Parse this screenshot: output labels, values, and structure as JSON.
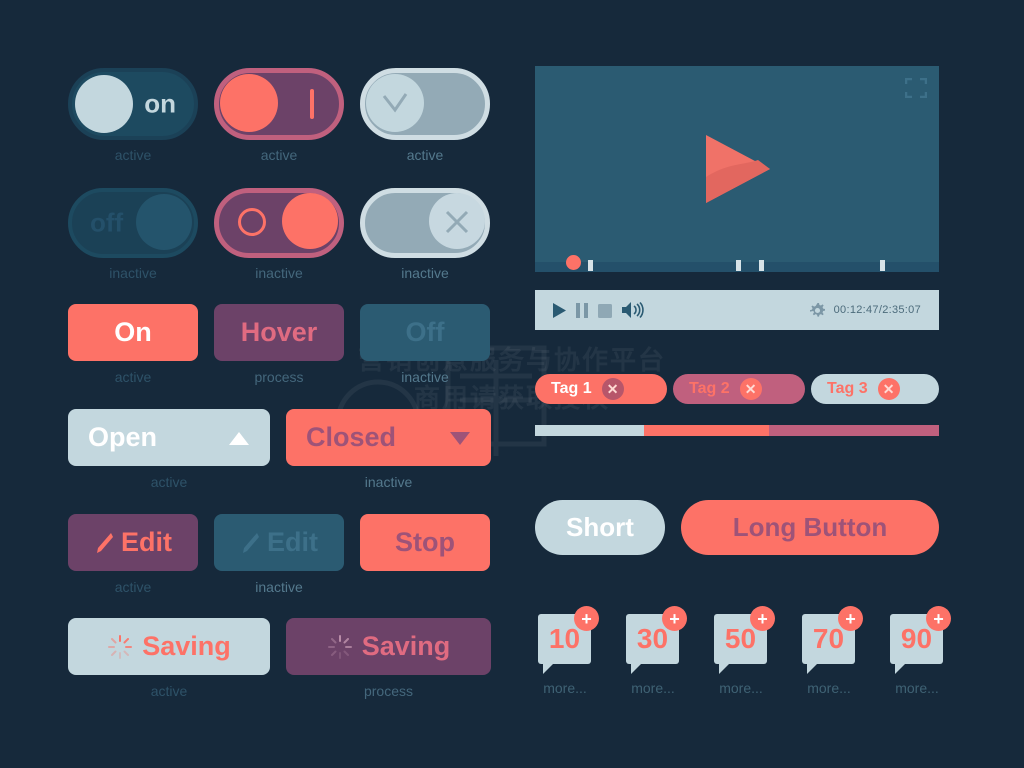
{
  "background_color": "#16293b",
  "palette": {
    "coral": "#fd7267",
    "purple": "#6c4268",
    "pink_border": "#c0607e",
    "light_grey": "#c3d7de",
    "teal": "#2b5b72",
    "dark_teal": "#1d4a60",
    "caption": "#2e5268",
    "white": "#ffffff"
  },
  "watermark": {
    "line1": "营销创意服务与协作平台",
    "line2": "商用请获取授权"
  },
  "toggles": [
    {
      "id": "toggle-on-dark",
      "label": "on",
      "caption": "active",
      "style": "dark-teal",
      "knob_side": "left",
      "knob_color": "#c3d7de",
      "label_color": "#c3d7de",
      "icon": "none"
    },
    {
      "id": "toggle-on-purple",
      "label": "|",
      "caption": "active",
      "style": "purple",
      "knob_side": "left",
      "knob_color": "#fd7267",
      "label_color": "#fd7267",
      "icon": "bar"
    },
    {
      "id": "toggle-on-grey",
      "label": "",
      "caption": "active",
      "style": "grey",
      "knob_side": "left",
      "knob_color": "#c3d7de",
      "label_color": "#93aab6",
      "icon": "check"
    },
    {
      "id": "toggle-off-dark",
      "label": "off",
      "caption": "inactive",
      "style": "dark-teal",
      "knob_side": "right",
      "knob_color": "#2b5b72",
      "label_color": "#24506a",
      "icon": "none"
    },
    {
      "id": "toggle-off-purple",
      "label": "O",
      "caption": "inactive",
      "style": "purple",
      "knob_side": "right",
      "knob_color": "#fd7267",
      "label_color": "#fd7267",
      "icon": "circle"
    },
    {
      "id": "toggle-off-grey",
      "label": "",
      "caption": "inactive",
      "style": "grey",
      "knob_side": "right",
      "knob_color": "#c7d8e0",
      "label_color": "#93aab6",
      "icon": "cross"
    }
  ],
  "state_buttons": [
    {
      "id": "btn-on",
      "label": "On",
      "caption": "active",
      "bg": "#fd7267",
      "fg": "#ffffff"
    },
    {
      "id": "btn-hover",
      "label": "Hover",
      "caption": "process",
      "bg": "#6c4268",
      "fg": "#e06b81"
    },
    {
      "id": "btn-off",
      "label": "Off",
      "caption": "inactive",
      "bg": "#2b5b72",
      "fg": "#3d7089"
    }
  ],
  "dropdown_buttons": [
    {
      "id": "btn-open",
      "label": "Open",
      "caption": "active",
      "bg": "#c3d7de",
      "fg": "#ffffff",
      "arrow": "up",
      "arrow_color": "#ffffff"
    },
    {
      "id": "btn-closed",
      "label": "Closed",
      "caption": "inactive",
      "bg": "#fd7267",
      "fg": "#9e5378",
      "arrow": "down",
      "arrow_color": "#9e5378"
    }
  ],
  "action_buttons": [
    {
      "id": "btn-edit-active",
      "label": "Edit",
      "caption": "active",
      "bg": "#6c4268",
      "fg": "#fd7267",
      "icon": "pencil-icon",
      "icon_color": "#fd7267"
    },
    {
      "id": "btn-edit-inactive",
      "label": "Edit",
      "caption": "inactive",
      "bg": "#2b5b72",
      "fg": "#3d7089",
      "icon": "pencil-icon",
      "icon_color": "#3d7089"
    },
    {
      "id": "btn-stop",
      "label": "Stop",
      "caption": "",
      "bg": "#fd7267",
      "fg": "#9e5378",
      "icon": "none",
      "icon_color": "#9e5378"
    }
  ],
  "saving_buttons": [
    {
      "id": "btn-saving-active",
      "label": "Saving",
      "caption": "active",
      "bg": "#c3d7de",
      "fg": "#fd7267",
      "icon": "spinner-icon",
      "icon_color": "#fd7267"
    },
    {
      "id": "btn-saving-process",
      "label": "Saving",
      "caption": "process",
      "bg": "#6c4268",
      "fg": "#e06b81",
      "icon": "spinner-icon",
      "icon_color": "#b98da8"
    }
  ],
  "video_player": {
    "play_icon": "play-icon",
    "fullscreen_icon": "fullscreen-icon",
    "settings_icon": "gear-icon",
    "time": "00:12:47/2:35:07",
    "controls": [
      "play-icon",
      "pause-icon",
      "stop-icon",
      "volume-icon"
    ],
    "screen_color": "#2b5b72",
    "bar_color": "#c3d7de",
    "progress_dot_position_pct": 8,
    "chapter_marks_pct": [
      13,
      50,
      57,
      88
    ]
  },
  "tags": [
    {
      "id": "tag-1",
      "label": "Tag 1",
      "bg": "#fd7267",
      "fg": "#ffffff",
      "x_bg": "#b7566a",
      "x_fg": "#ffd9d3"
    },
    {
      "id": "tag-2",
      "label": "Tag 2",
      "bg": "#c0607e",
      "fg": "#fd7267",
      "x_bg": "#fd7267",
      "x_fg": "#ffd9d3"
    },
    {
      "id": "tag-3",
      "label": "Tag 3",
      "bg": "#c3d7de",
      "fg": "#fd7267",
      "x_bg": "#fd7267",
      "x_fg": "#ffd9d3"
    }
  ],
  "segmented_bar": [
    {
      "id": "segment-light",
      "color": "#c3d7de",
      "width_pct": 27
    },
    {
      "id": "segment-coral",
      "color": "#fd7267",
      "width_pct": 31
    },
    {
      "id": "segment-pink",
      "color": "#c0607e",
      "width_pct": 42
    }
  ],
  "pill_buttons": [
    {
      "id": "btn-short",
      "label": "Short",
      "bg": "#c3d7de",
      "fg": "#ffffff"
    },
    {
      "id": "btn-long-button",
      "label": "Long Button",
      "bg": "#fd7267",
      "fg": "#9e5378"
    }
  ],
  "markers": [
    {
      "id": "marker-10",
      "count": "10",
      "more": "more...",
      "badge": "+"
    },
    {
      "id": "marker-30",
      "count": "30",
      "more": "more...",
      "badge": "+"
    },
    {
      "id": "marker-50",
      "count": "50",
      "more": "more...",
      "badge": "+"
    },
    {
      "id": "marker-70",
      "count": "70",
      "more": "more...",
      "badge": "+"
    },
    {
      "id": "marker-90",
      "count": "90",
      "more": "more...",
      "badge": "+"
    }
  ]
}
